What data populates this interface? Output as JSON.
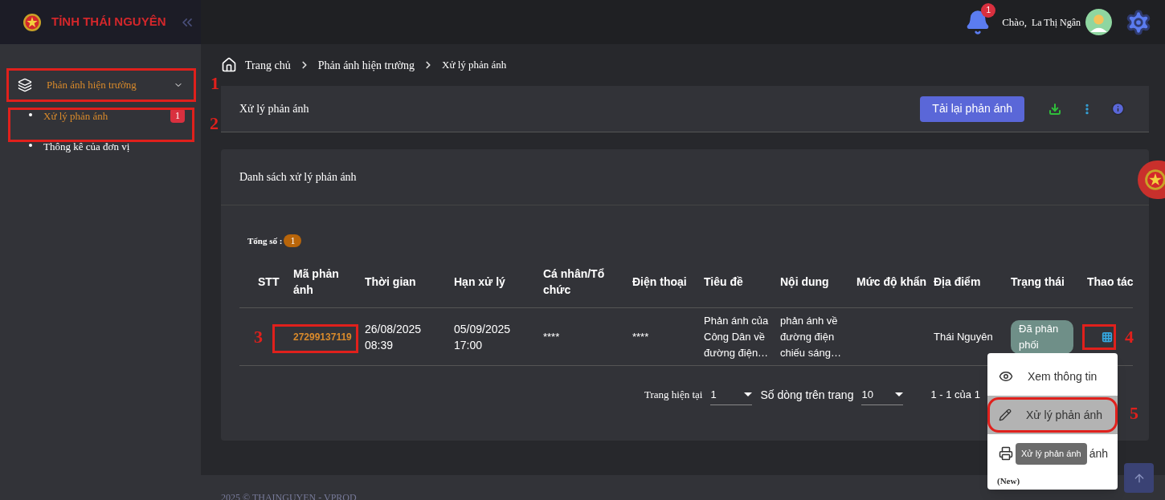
{
  "header": {
    "brand": "TỈNH THÁI NGUYÊN",
    "notification_count": "1",
    "greeting": "Chào,",
    "user_name": "La Thị Ngân"
  },
  "sidebar": {
    "groups": [
      {
        "label": "Phản ánh hiện trường",
        "expanded": true,
        "children": [
          {
            "label": "Xử lý phản ánh",
            "selected": true,
            "badge": "1"
          },
          {
            "label": "Thông kê của đơn vị",
            "selected": false
          }
        ]
      }
    ]
  },
  "breadcrumb": [
    "Trang chủ",
    "Phản ánh hiện trường",
    "Xử lý phản ánh"
  ],
  "page_header": {
    "title": "Xử lý phản ánh",
    "reload_button": "Tải lại phản ánh"
  },
  "list": {
    "title": "Danh sách xử lý phản ánh",
    "total_label": "Tổng số :",
    "total": "1",
    "columns": [
      "STT",
      "Mã phản ánh",
      "Thời gian",
      "Hạn xử lý",
      "Cá nhân/Tổ chức",
      "Điện thoại",
      "Tiêu đề",
      "Nội dung",
      "Mức độ khẩn",
      "Địa điểm",
      "Trạng thái",
      "Thao tác"
    ],
    "rows": [
      {
        "code": "27299137119",
        "time": "26/08/2025 08:39",
        "deadline": "05/09/2025 17:00",
        "person": "****",
        "phone": "****",
        "title": "Phản ánh của Công Dân về đường điện…",
        "content": "phản ánh về đường điện chiếu sáng…",
        "location": "Thái Nguyên",
        "status": "Đã phân phối"
      }
    ]
  },
  "pagination": {
    "page_label": "Trang hiện tại",
    "page": "1",
    "rows_label": "Số dòng trên trang",
    "rows_per_page": "10",
    "range": "1 - 1 của 1"
  },
  "action_menu": {
    "items": [
      {
        "kind": "view",
        "label": "Xem thông tin",
        "selected": false
      },
      {
        "kind": "edit",
        "label": "Xử lý phản ánh",
        "selected": true
      },
      {
        "kind": "print",
        "label": "ánh",
        "selected": false
      }
    ],
    "note": "(New)",
    "tooltip": "Xử lý phản ánh"
  },
  "annotations": [
    "1",
    "2",
    "3",
    "4",
    "5"
  ],
  "footer": "2025 © THAINGUYEN - VPROD"
}
